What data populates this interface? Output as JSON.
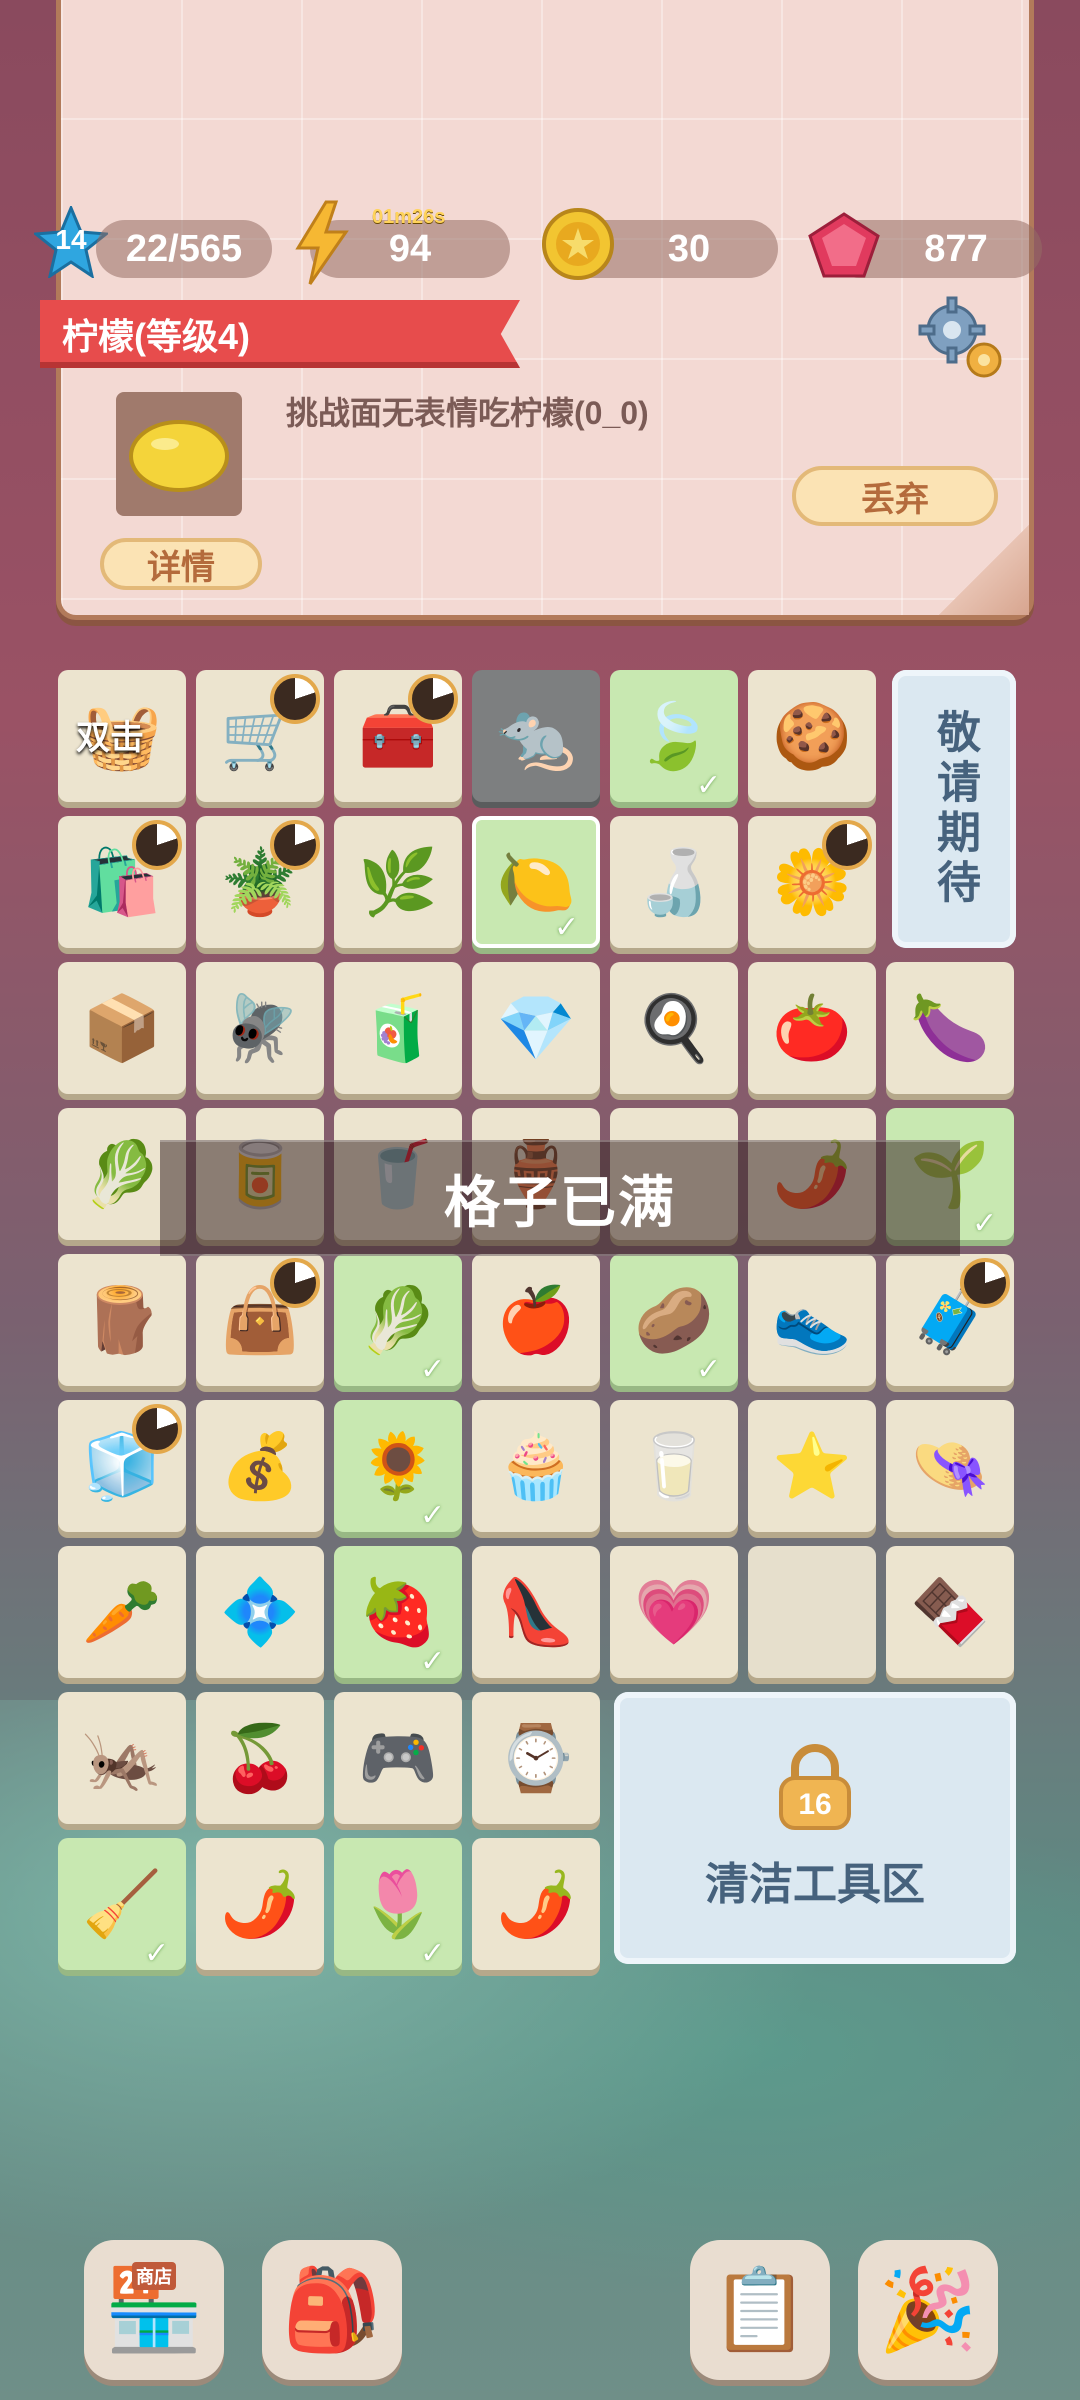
{
  "stats": {
    "level": "14",
    "xp": "22/565",
    "energy_timer": "01m26s",
    "energy": "94",
    "coins": "30",
    "gems": "877"
  },
  "task": {
    "ribbon_title": "柠檬(等级4)",
    "description": "挑战面无表情吃柠檬(0_0)",
    "details_button": "详情",
    "discard_button": "丢弃"
  },
  "grid": {
    "double_tap_label": "双击",
    "coming_soon": "敬请期待",
    "full_banner": "格子已满",
    "locked_zone_level": "16",
    "locked_zone_label": "清洁工具区"
  },
  "dock": {
    "shop_sign": "商店"
  },
  "colors": {
    "ribbon_red": "#e74c4c",
    "panel_pink": "#f3d9d3",
    "cell_cream": "#ece4cf",
    "cell_green": "#c8e8b1"
  }
}
